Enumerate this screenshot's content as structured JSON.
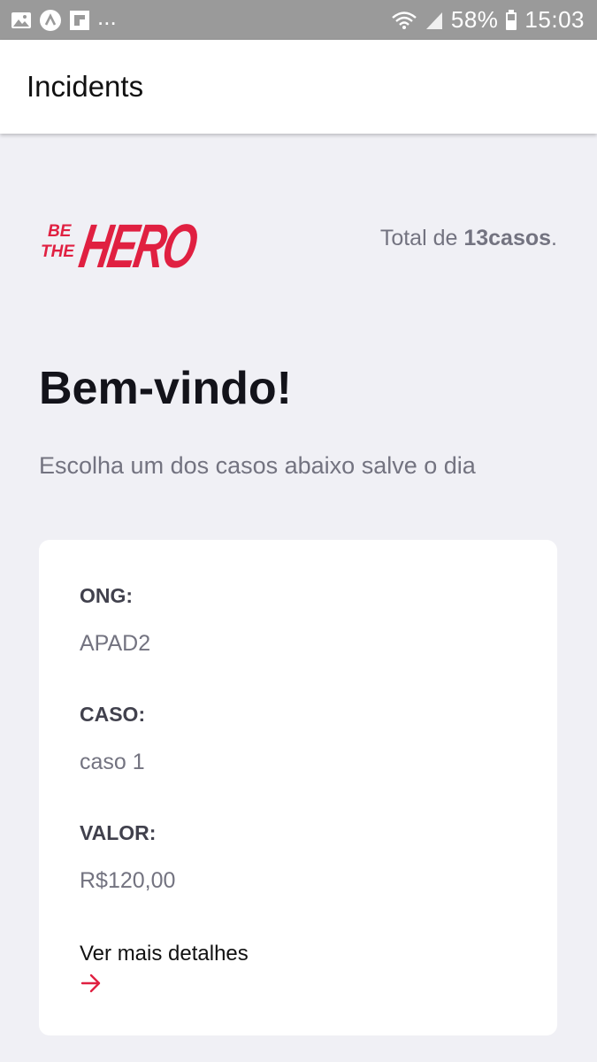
{
  "status_bar": {
    "battery": "58%",
    "time": "15:03",
    "overflow": "..."
  },
  "header": {
    "title": "Incidents"
  },
  "logo": {
    "line1": "BE",
    "line2": "THE",
    "word": "HERO",
    "color": "#e02041"
  },
  "summary": {
    "prefix": "Total de ",
    "count": "13casos",
    "suffix": "."
  },
  "welcome": {
    "title": "Bem-vindo!",
    "description": "Escolha um dos casos abaixo salve o dia"
  },
  "incident": {
    "ong_label": "ONG:",
    "ong_value": "APAD2",
    "case_label": "CASO:",
    "case_value": "caso 1",
    "value_label": "VALOR:",
    "value_value": "R$120,00",
    "details_label": "Ver mais detalhes"
  },
  "colors": {
    "accent": "#e02041",
    "background": "#f0f0f5",
    "label": "#41414d",
    "muted": "#737380"
  }
}
